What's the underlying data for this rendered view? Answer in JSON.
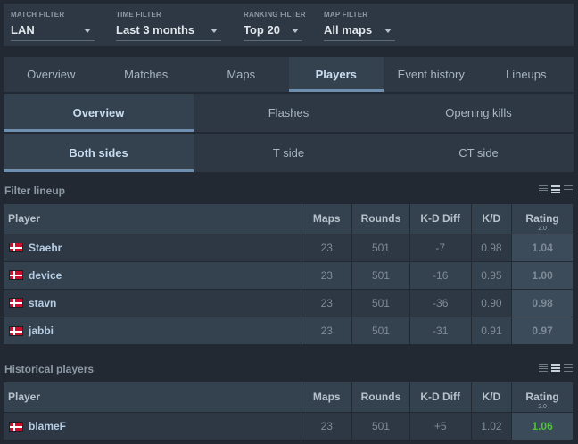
{
  "filters": [
    {
      "label": "MATCH FILTER",
      "value": "LAN"
    },
    {
      "label": "TIME FILTER",
      "value": "Last 3 months"
    },
    {
      "label": "RANKING FILTER",
      "value": "Top 20"
    },
    {
      "label": "MAP FILTER",
      "value": "All maps"
    }
  ],
  "main_tabs": [
    "Overview",
    "Matches",
    "Maps",
    "Players",
    "Event history",
    "Lineups"
  ],
  "sub_tabs": [
    "Overview",
    "Flashes",
    "Opening kills"
  ],
  "side_tabs": [
    "Both sides",
    "T side",
    "CT side"
  ],
  "lineup": {
    "title": "Filter lineup",
    "headers": {
      "player": "Player",
      "maps": "Maps",
      "rounds": "Rounds",
      "kd_diff": "K-D Diff",
      "kd": "K/D",
      "rating": "Rating",
      "rating_version": "2.0"
    },
    "rows": [
      {
        "name": "Staehr",
        "maps": "23",
        "rounds": "501",
        "kd_diff": "-7",
        "kd": "0.98",
        "rating": "1.04"
      },
      {
        "name": "device",
        "maps": "23",
        "rounds": "501",
        "kd_diff": "-16",
        "kd": "0.95",
        "rating": "1.00"
      },
      {
        "name": "stavn",
        "maps": "23",
        "rounds": "501",
        "kd_diff": "-36",
        "kd": "0.90",
        "rating": "0.98"
      },
      {
        "name": "jabbi",
        "maps": "23",
        "rounds": "501",
        "kd_diff": "-31",
        "kd": "0.91",
        "rating": "0.97"
      }
    ]
  },
  "historical": {
    "title": "Historical players",
    "headers": {
      "player": "Player",
      "maps": "Maps",
      "rounds": "Rounds",
      "kd_diff": "K-D Diff",
      "kd": "K/D",
      "rating": "Rating",
      "rating_version": "2.0"
    },
    "rows": [
      {
        "name": "blameF",
        "maps": "23",
        "rounds": "501",
        "kd_diff": "+5",
        "kd": "1.02",
        "rating": "1.06"
      }
    ]
  },
  "colors": {
    "negative": "#e0353a",
    "positive": "#37b93c",
    "accent": "#6f8fb0"
  }
}
